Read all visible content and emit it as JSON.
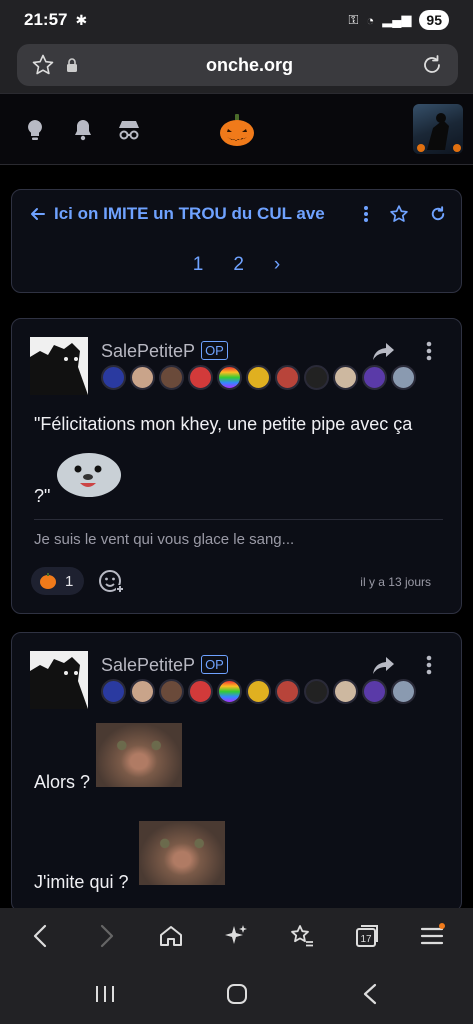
{
  "status": {
    "time": "21:57",
    "battery": "95"
  },
  "browser": {
    "url": "onche.org"
  },
  "topic": {
    "title": "Ici on IMITE un TROU du CUL ave",
    "pages": [
      "1",
      "2"
    ],
    "next": "›"
  },
  "posts": [
    {
      "author": "SalePetiteP",
      "op_label": "OP",
      "text_a": "\"Félicitations mon khey, une petite pipe avec ça",
      "text_b": "?\"",
      "signature": "Je suis le vent qui vous glace le sang...",
      "reaction_count": "1",
      "date": "il y a 13 jours"
    },
    {
      "author": "SalePetiteP",
      "op_label": "OP",
      "text_a": "Alors ?",
      "text_b": "J'imite qui ?"
    }
  ],
  "colors": {
    "accent": "#6fa2ff",
    "card_bg": "#0c0e16",
    "page_bg": "#000000"
  }
}
